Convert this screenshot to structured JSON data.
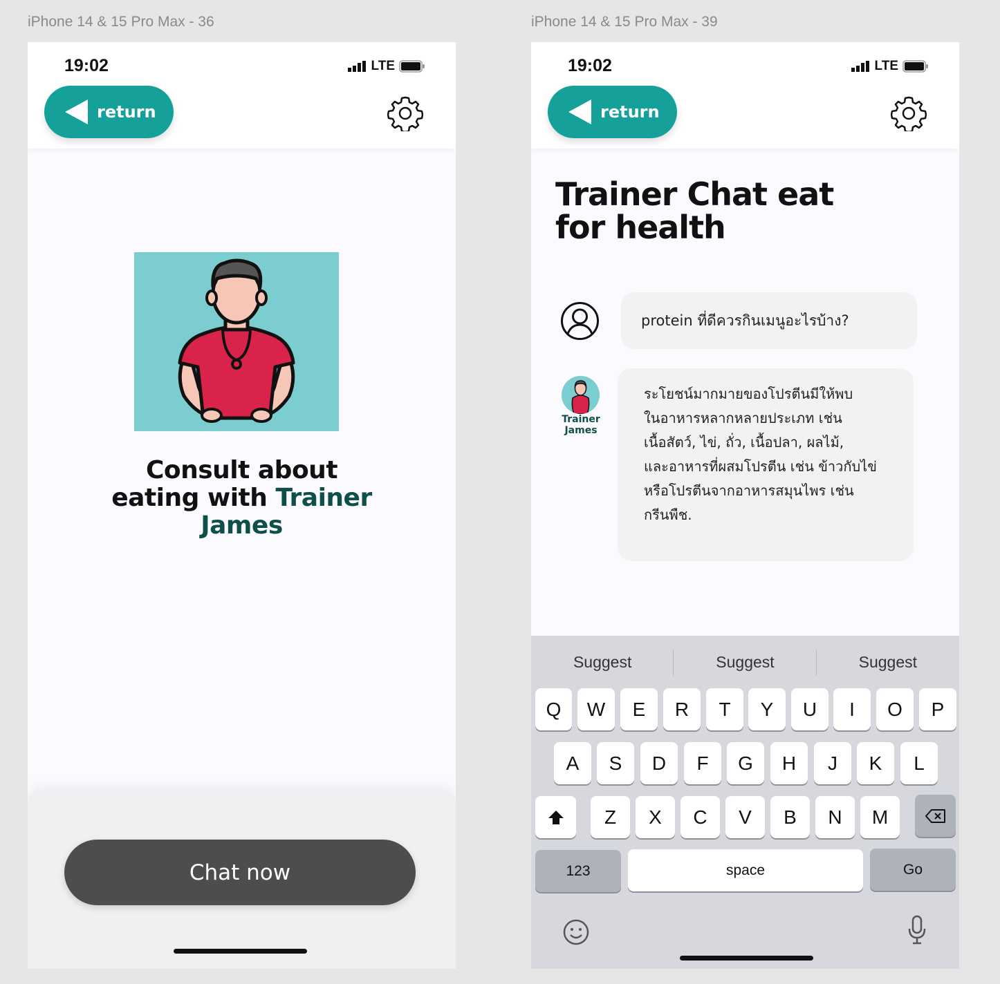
{
  "frames": [
    {
      "label": "iPhone 14 & 15 Pro Max - 36"
    },
    {
      "label": "iPhone 14 & 15 Pro Max - 39"
    }
  ],
  "status_bar": {
    "time": "19:02",
    "network": "LTE"
  },
  "header": {
    "return_label": "return"
  },
  "screen1": {
    "headline_line1": "Consult about",
    "headline_line2_prefix": "eating with ",
    "headline_line2_highlight": "Trainer",
    "headline_line3": "James",
    "chat_button_label": "Chat now"
  },
  "screen2": {
    "title_line1": "Trainer Chat eat",
    "title_line2": "for health",
    "user_message": "protein ที่ดีควรกินเมนูอะไรบ้าง?",
    "trainer_name_line1": "Trainer",
    "trainer_name_line2": "James",
    "bot_message_lines": [
      "ระโยชน์มากมายของโปรตีนมีให้พบ",
      "ในอาหารหลากหลายประเภท เช่น",
      "เนื้อสัตว์, ไข่, ถั่ว, เนื้อปลา, ผลไม้,",
      "และอาหารที่ผสมโปรตีน เช่น ข้าวกับไข่",
      "หรือโปรตีนจากอาหารสมุนไพร เช่น",
      "กรีนพืช."
    ]
  },
  "keyboard": {
    "suggestions": [
      "Suggest",
      "Suggest",
      "Suggest"
    ],
    "row1": [
      "Q",
      "W",
      "E",
      "R",
      "T",
      "Y",
      "U",
      "I",
      "O",
      "P"
    ],
    "row2": [
      "A",
      "S",
      "D",
      "F",
      "G",
      "H",
      "J",
      "K",
      "L"
    ],
    "row3": [
      "Z",
      "X",
      "C",
      "V",
      "B",
      "N",
      "M"
    ],
    "numbers_label": "123",
    "space_label": "space",
    "go_label": "Go"
  },
  "colors": {
    "accent": "#15a09a",
    "brand_dark": "#0f4f4a",
    "avatar_bg": "#7ccdcf",
    "shirt": "#d9234a",
    "chat_button": "#4d4d4d"
  },
  "icons": [
    "signal-icon",
    "battery-icon",
    "back-arrow-icon",
    "gear-icon",
    "user-icon",
    "shift-icon",
    "backspace-icon",
    "emoji-icon",
    "mic-icon"
  ]
}
